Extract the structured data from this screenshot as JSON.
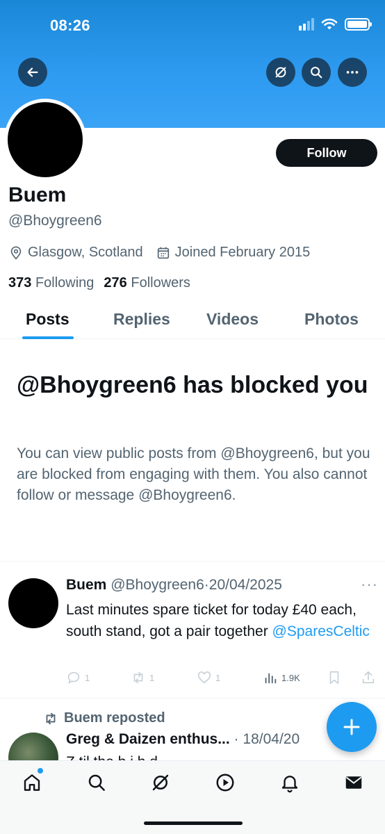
{
  "status_bar": {
    "time": "08:26"
  },
  "header": {
    "back_icon": "arrow-left-icon",
    "grok_icon": "grok-icon",
    "search_icon": "search-icon",
    "more_icon": "more-icon"
  },
  "profile": {
    "follow_label": "Follow",
    "name": "Buem",
    "handle": "@Bhoygreen6",
    "location": "Glasgow, Scotland",
    "joined": "Joined February 2015",
    "following_count": "373",
    "following_label": "Following",
    "followers_count": "276",
    "followers_label": "Followers"
  },
  "tabs": [
    {
      "label": "Posts",
      "active": true
    },
    {
      "label": "Replies",
      "active": false
    },
    {
      "label": "Videos",
      "active": false
    },
    {
      "label": "Photos",
      "active": false
    }
  ],
  "blocked": {
    "title": "@Bhoygreen6 has blocked you",
    "message": "You can view public posts from @Bhoygreen6, but you are blocked from engaging with them. You also cannot follow or message @Bhoygreen6."
  },
  "post": {
    "author": "Buem",
    "handle": "@Bhoygreen6",
    "separator": "·",
    "date": "20/04/2025",
    "more": "···",
    "text": "Last minutes spare ticket for today £40 each, south stand, got a pair together ",
    "mention": "@SparesCeltic",
    "replies": "1",
    "reposts": "1",
    "likes": "1",
    "views": "1.9K"
  },
  "repost": {
    "label": "Buem reposted",
    "author": "Greg & Daizen enthus...",
    "separator": " · ",
    "date": "18/04/20",
    "text": "Z                       til the b   i   h   d"
  },
  "fab": {
    "icon": "plus-icon"
  },
  "bottom_nav": [
    "home-icon",
    "search-icon",
    "grok-icon",
    "video-icon",
    "bell-icon",
    "mail-icon"
  ],
  "colors": {
    "accent": "#1d9bf0",
    "banner": "#2d9af0",
    "text": "#0f1419",
    "secondary": "#536471"
  }
}
